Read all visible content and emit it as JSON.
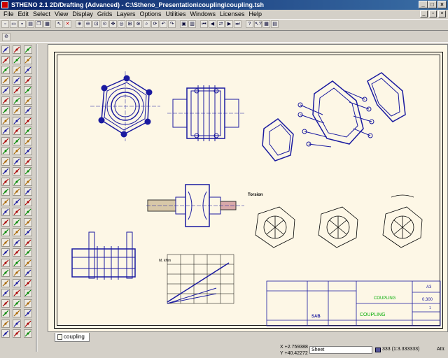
{
  "window": {
    "title": "STHENO 2.1 2D/Drafting (Advanced) - C:\\Stheno_Presentation\\coupling\\coupling.tsh"
  },
  "menu": [
    "File",
    "Edit",
    "Select",
    "View",
    "Display",
    "Grids",
    "Layers",
    "Options",
    "Utilities",
    "Windows",
    "Licenses",
    "Help"
  ],
  "drawing": {
    "torsion_label": "Torsion",
    "chart_label": "M, kNm",
    "title_block": {
      "title_top": "COUPLING",
      "title_main": "COUPLING",
      "format": "A3",
      "scale": "0.300",
      "sheet": "1",
      "logo": "SAB"
    }
  },
  "tabs": {
    "active": "coupling"
  },
  "status": {
    "x_coord": "X +2.759388",
    "y_coord": "Y +40.42272",
    "sheet_field": "Sheet",
    "scale": "333 (1:3.333333)",
    "attr": "Attr."
  }
}
